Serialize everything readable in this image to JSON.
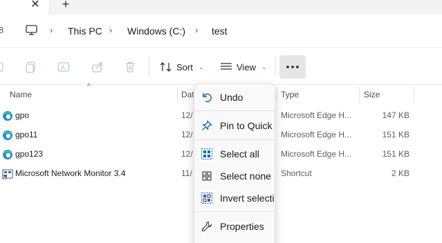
{
  "tabs": {
    "close_glyph": "✕",
    "new_tab_glyph": "+"
  },
  "address": {
    "crumbs": [
      "This PC",
      "Windows (C:)",
      "test"
    ],
    "separator": "›"
  },
  "commandbar": {
    "sort_label": "Sort",
    "view_label": "View",
    "more_glyph": "•••",
    "icons": [
      "cut-icon",
      "copy-icon",
      "rename-icon",
      "share-icon",
      "delete-icon",
      "sort-icon",
      "view-icon",
      "more-icon"
    ]
  },
  "columns": {
    "name": "Name",
    "date": "Dat",
    "type": "Type",
    "size": "Size"
  },
  "files": [
    {
      "name": "gpo",
      "date": "12/",
      "type": "Microsoft Edge H...",
      "size": "147 KB",
      "icon": "edge-icon"
    },
    {
      "name": "gpo11",
      "date": "12/",
      "type": "Microsoft Edge H...",
      "size": "151 KB",
      "icon": "edge-icon"
    },
    {
      "name": "gpo123",
      "date": "12/",
      "type": "Microsoft Edge H...",
      "size": "151 KB",
      "icon": "edge-icon"
    },
    {
      "name": "Microsoft Network Monitor 3.4",
      "date": "11/",
      "type": "Shortcut",
      "size": "2 KB",
      "icon": "shortcut-icon"
    }
  ],
  "menu": {
    "undo": "Undo",
    "pin": "Pin to Quick",
    "select_all": "Select all",
    "select_none": "Select none",
    "invert": "Invert selectio",
    "properties": "Properties"
  },
  "colors": {
    "accent": "#0067c0",
    "menu_bg": "#f9f9f9",
    "more_active_bg": "#e6e6e6"
  }
}
